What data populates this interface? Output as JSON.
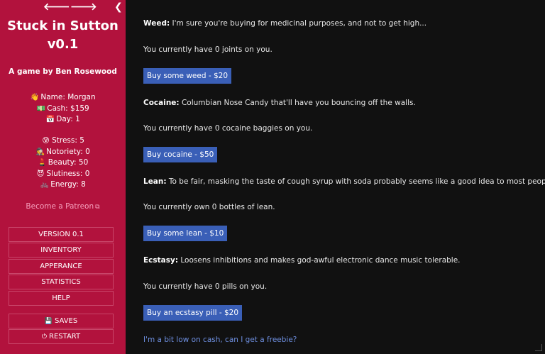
{
  "sidebar": {
    "back_glyph": "🡐",
    "forward_glyph": "🡒",
    "collapse_glyph": "❮",
    "title_line1": "Stuck in Sutton",
    "title_line2": "v0.1",
    "author": "A game by Ben Rosewood",
    "stats_basic": [
      {
        "icon": "👋",
        "icon_name": "waving-hand-icon",
        "label": "Name: Morgan"
      },
      {
        "icon": "💵",
        "icon_name": "cash-icon",
        "label": "Cash: $159"
      },
      {
        "icon": "📅",
        "icon_name": "calendar-icon",
        "label": "Day: 1"
      }
    ],
    "stats_attr": [
      {
        "icon": "😰",
        "icon_name": "stress-face-icon",
        "label": "Stress: 5"
      },
      {
        "icon": "🕵",
        "icon_name": "detective-icon",
        "label": "Notoriety: 0"
      },
      {
        "icon": "💄",
        "icon_name": "lipstick-icon",
        "label": "Beauty: 50"
      },
      {
        "icon": "😈",
        "icon_name": "devil-face-icon",
        "label": "Slutiness: 0"
      },
      {
        "icon": "🚲",
        "icon_name": "bike-icon",
        "label": "Energy: 8"
      }
    ],
    "patreon": "Become a Patreon",
    "patreon_icon": "⧉",
    "menu": [
      "VERSION 0.1",
      "INVENTORY",
      "APPERANCE",
      "STATISTICS",
      "HELP"
    ],
    "saves_label": "SAVES",
    "restart_label": "RESTART",
    "saves_icon": "💾",
    "restart_icon": "⏻"
  },
  "main": {
    "weed": {
      "heading": "Weed:",
      "description": " I'm sure you're buying for medicinal purposes, and not to get high...",
      "status": "You currently have 0 joints on you.",
      "button": "Buy some weed - $20"
    },
    "cocaine": {
      "heading": "Cocaine:",
      "description": " Columbian Nose Candy that'll have you bouncing off the walls.",
      "status": "You currently have 0 cocaine baggies on you.",
      "button": "Buy cocaine - $50"
    },
    "lean": {
      "heading": "Lean:",
      "description": " To be fair, masking the taste of cough syrup with soda probably seems like a good idea to most people.",
      "status": "You currently own 0 bottles of lean.",
      "button": "Buy some lean - $10"
    },
    "ecstasy": {
      "heading": "Ecstasy:",
      "description": " Loosens inhibitions and makes god-awful electronic dance music tolerable.",
      "status": "You currently have 0 pills on you.",
      "button": "Buy an ecstasy pill - $20"
    },
    "freebie": "I'm a bit low on cash, can I get a freebie?"
  },
  "colors": {
    "sidebar_bg": "#b2123d",
    "main_bg": "#111111",
    "button_bg": "#3a5fb7",
    "link": "#6e8fe0",
    "patreon_link": "#f6a0bd"
  }
}
